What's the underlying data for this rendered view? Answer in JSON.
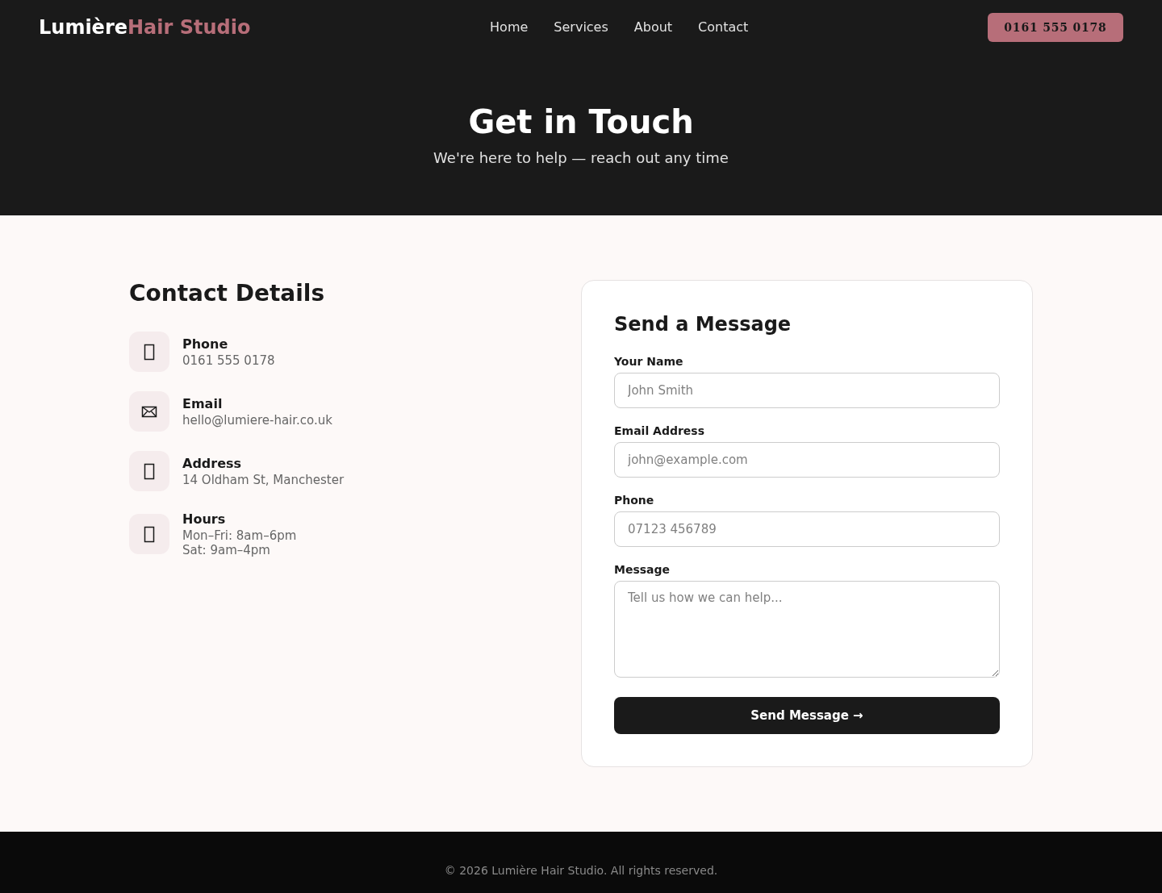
{
  "header": {
    "logo": {
      "primary": "Lumière",
      "accent": "Hair Studio"
    },
    "nav": [
      "Home",
      "Services",
      "About",
      "Contact"
    ],
    "phone_button": "0161 555 0178"
  },
  "hero": {
    "title": "Get in Touch",
    "subtitle": "We're here to help — reach out any time"
  },
  "contact_details": {
    "title": "Contact Details",
    "items": [
      {
        "kind": "phone",
        "label": "Phone",
        "lines": [
          "0161 555 0178"
        ]
      },
      {
        "kind": "email",
        "label": "Email",
        "lines": [
          "hello@lumiere-hair.co.uk"
        ]
      },
      {
        "kind": "address",
        "label": "Address",
        "lines": [
          "14 Oldham St, Manchester"
        ]
      },
      {
        "kind": "hours",
        "label": "Hours",
        "lines": [
          "Mon–Fri: 8am–6pm",
          "Sat: 9am–4pm"
        ]
      }
    ]
  },
  "form": {
    "title": "Send a Message",
    "fields": [
      {
        "kind": "input",
        "label": "Your Name",
        "placeholder": "John Smith"
      },
      {
        "kind": "input",
        "label": "Email Address",
        "placeholder": "john@example.com"
      },
      {
        "kind": "input",
        "label": "Phone",
        "placeholder": "07123 456789"
      },
      {
        "kind": "textarea",
        "label": "Message",
        "placeholder": "Tell us how we can help..."
      }
    ],
    "submit": "Send Message →"
  },
  "footer": {
    "copyright": "© 2026 Lumière Hair Studio. All rights reserved."
  }
}
